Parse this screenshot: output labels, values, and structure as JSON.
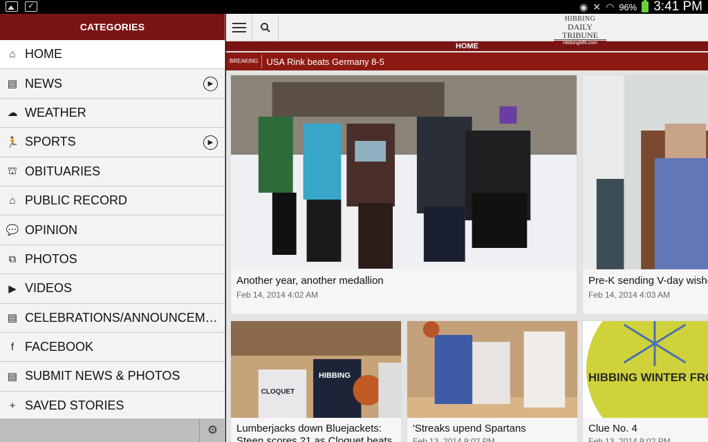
{
  "status_bar": {
    "battery": "96%",
    "time": "3:41 PM"
  },
  "drawer": {
    "title": "CATEGORIES",
    "items": [
      {
        "label": "HOME",
        "icon": "home-icon",
        "glyph": "⌂",
        "active": true,
        "arrow": false
      },
      {
        "label": "NEWS",
        "icon": "newspaper-icon",
        "glyph": "▤",
        "active": false,
        "arrow": true
      },
      {
        "label": "WEATHER",
        "icon": "weather-icon",
        "glyph": "☁",
        "active": false,
        "arrow": false
      },
      {
        "label": "SPORTS",
        "icon": "runner-icon",
        "glyph": "🏃",
        "active": false,
        "arrow": true
      },
      {
        "label": "OBITUARIES",
        "icon": "tombstone-icon",
        "glyph": "⛫",
        "active": false,
        "arrow": false
      },
      {
        "label": "PUBLIC RECORD",
        "icon": "courthouse-icon",
        "glyph": "⌂",
        "active": false,
        "arrow": false
      },
      {
        "label": "OPINION",
        "icon": "speech-bubble-icon",
        "glyph": "💬",
        "active": false,
        "arrow": false
      },
      {
        "label": "PHOTOS",
        "icon": "photos-icon",
        "glyph": "⧉",
        "active": false,
        "arrow": false
      },
      {
        "label": "VIDEOS",
        "icon": "film-icon",
        "glyph": "▶",
        "active": false,
        "arrow": false
      },
      {
        "label": "CELEBRATIONS/ANNOUNCEMENTS",
        "icon": "documents-icon",
        "glyph": "▤",
        "active": false,
        "arrow": false
      },
      {
        "label": "FACEBOOK",
        "icon": "facebook-icon",
        "glyph": "f",
        "active": false,
        "arrow": false
      },
      {
        "label": "SUBMIT NEWS & PHOTOS",
        "icon": "documents-icon",
        "glyph": "▤",
        "active": false,
        "arrow": false
      },
      {
        "label": "SAVED STORIES",
        "icon": "saved-icon",
        "glyph": "+",
        "active": false,
        "arrow": false
      }
    ]
  },
  "header": {
    "logo_line1": "HIBBING",
    "logo_line2": "DAILY TRIBUNE",
    "logo_line3": "HibbingMN.com",
    "section": "HOME"
  },
  "breaking": {
    "tag": "BREAKING",
    "text": "USA Rink beats Germany 8-5"
  },
  "stories": [
    {
      "headline": "Another year, another medallion",
      "date": "Feb 14, 2014 4:02 AM"
    },
    {
      "headline": "Pre-K sending V-day wishes",
      "date": "Feb 14, 2014 4:03 AM"
    },
    {
      "headline": "Lumberjacks down Bluejackets: Steen scores 21 as Cloquet beats",
      "date": ""
    },
    {
      "headline": "'Streaks upend Spartans",
      "date": "Feb 13, 2014 9:02 PM"
    },
    {
      "headline": "Clue No. 4",
      "date": "Feb 13, 2014 9:02 PM"
    }
  ],
  "photo_text": {
    "jersey1": "HIBBING",
    "jersey2": "CLOQUET",
    "banner": "HIBBING WINTER FROLIC"
  },
  "colors": {
    "brand": "#7a1414",
    "breaking_bar": "#8c1a13"
  }
}
